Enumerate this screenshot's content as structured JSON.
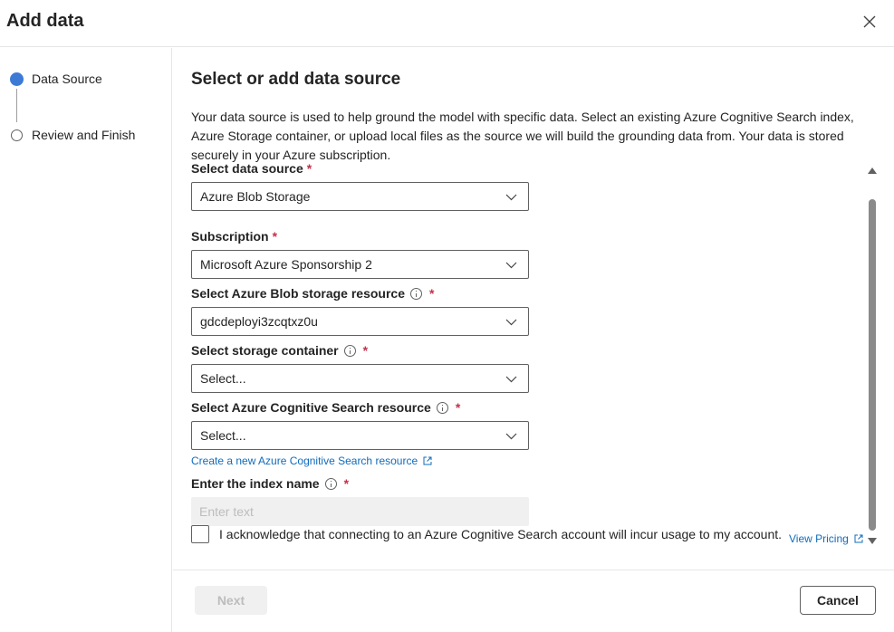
{
  "dialog": {
    "title": "Add data"
  },
  "steps": [
    {
      "label": "Data Source",
      "state": "active"
    },
    {
      "label": "Review and Finish",
      "state": "inactive"
    }
  ],
  "main": {
    "title": "Select or add data source",
    "description": "Your data source is used to help ground the model with specific data. Select an existing Azure Cognitive Search index, Azure Storage container, or upload local files as the source we will build the grounding data from. Your data is stored securely in your Azure subscription."
  },
  "fields": {
    "data_source": {
      "label": "Select data source",
      "required": "*",
      "value": "Azure Blob Storage"
    },
    "subscription": {
      "label": "Subscription",
      "required": "*",
      "value": "Microsoft Azure Sponsorship 2"
    },
    "blob_resource": {
      "label": "Select Azure Blob storage resource",
      "required": "*",
      "value": "gdcdeployi3zcqtxz0u"
    },
    "storage_container": {
      "label": "Select storage container",
      "required": "*",
      "value": "Select..."
    },
    "search_resource": {
      "label": "Select Azure Cognitive Search resource",
      "required": "*",
      "value": "Select..."
    },
    "create_search_link": "Create a new Azure Cognitive Search resource",
    "index_name": {
      "label": "Enter the index name",
      "required": "*",
      "placeholder": "Enter text"
    },
    "acknowledge": {
      "label": "I acknowledge that connecting to an Azure Cognitive Search account will incur usage to my account.",
      "checked": false
    },
    "pricing_link": "View Pricing"
  },
  "footer": {
    "next_label": "Next",
    "cancel_label": "Cancel"
  },
  "colors": {
    "accent": "#3d7ad6",
    "link": "#0f6cbd",
    "required": "#c4314b"
  }
}
